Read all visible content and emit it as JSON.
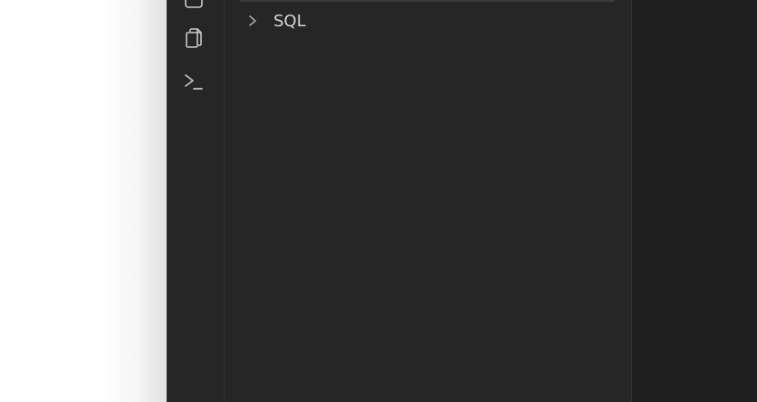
{
  "activity_bar": {
    "items": [
      {
        "icon": "window-icon"
      },
      {
        "icon": "files-copy-icon"
      },
      {
        "icon": "terminal-icon"
      }
    ]
  },
  "sidebar": {
    "tree": [
      {
        "label": "SQL",
        "expanded": false,
        "icon": "chevron-right-icon"
      }
    ]
  },
  "colors": {
    "window_bg": "#262626",
    "editor_bg": "#1e1e1e",
    "icon": "#c8c8c8",
    "text": "#d6d6d6"
  }
}
